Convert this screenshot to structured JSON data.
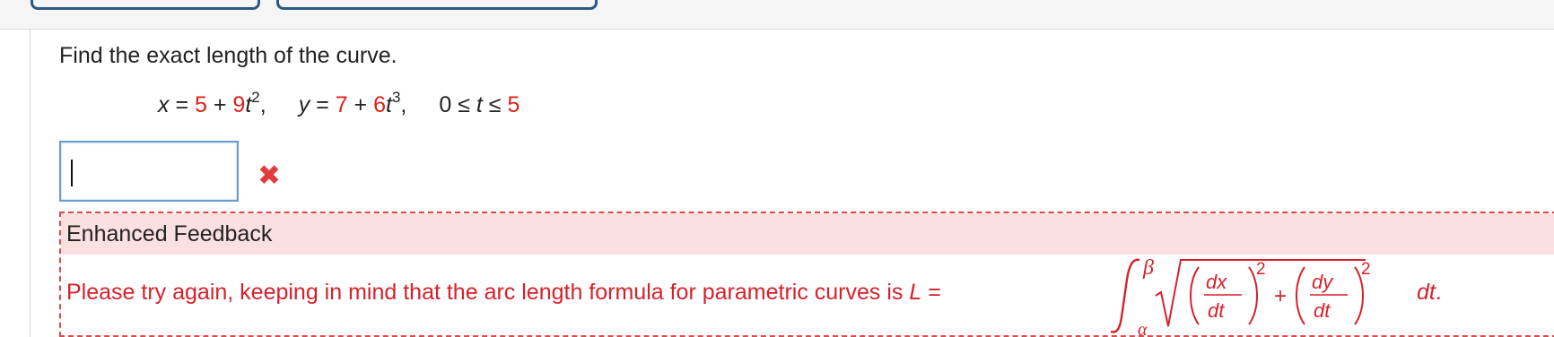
{
  "question": {
    "text": "Find the exact length of the curve."
  },
  "equation": {
    "x_label": "x",
    "eq1": " = ",
    "x_const": "5",
    "plus1": " + ",
    "x_coef": "9",
    "x_var": "t",
    "x_exp": "2",
    "comma1": ",",
    "y_label": "y",
    "eq2": " = ",
    "y_const": "7",
    "plus2": " + ",
    "y_coef": "6",
    "y_var": "t",
    "y_exp": "3",
    "comma2": ",",
    "range_start": "0 ≤ ",
    "range_var": "t",
    "range_le": " ≤ ",
    "range_end": "5"
  },
  "answer": {
    "value": "",
    "placeholder": ""
  },
  "status": {
    "incorrect_icon": "close-icon",
    "icon_glyph": "✖"
  },
  "feedback": {
    "title": "Enhanced Feedback",
    "text": "Please try again, keeping in mind that the arc length formula for parametric curves is ",
    "L_var": "L",
    "equals": " =",
    "upper": "β",
    "lower": "α",
    "dx": "dx",
    "dy": "dy",
    "dt": "dt",
    "exp": "2",
    "plus": "+",
    "dt_end": "dt",
    "period": "."
  },
  "colors": {
    "accent_red": "#e0201a",
    "feedback_bg": "#fbe0e1",
    "input_border": "#6a9bd1",
    "tab_border": "#2a5a86"
  }
}
